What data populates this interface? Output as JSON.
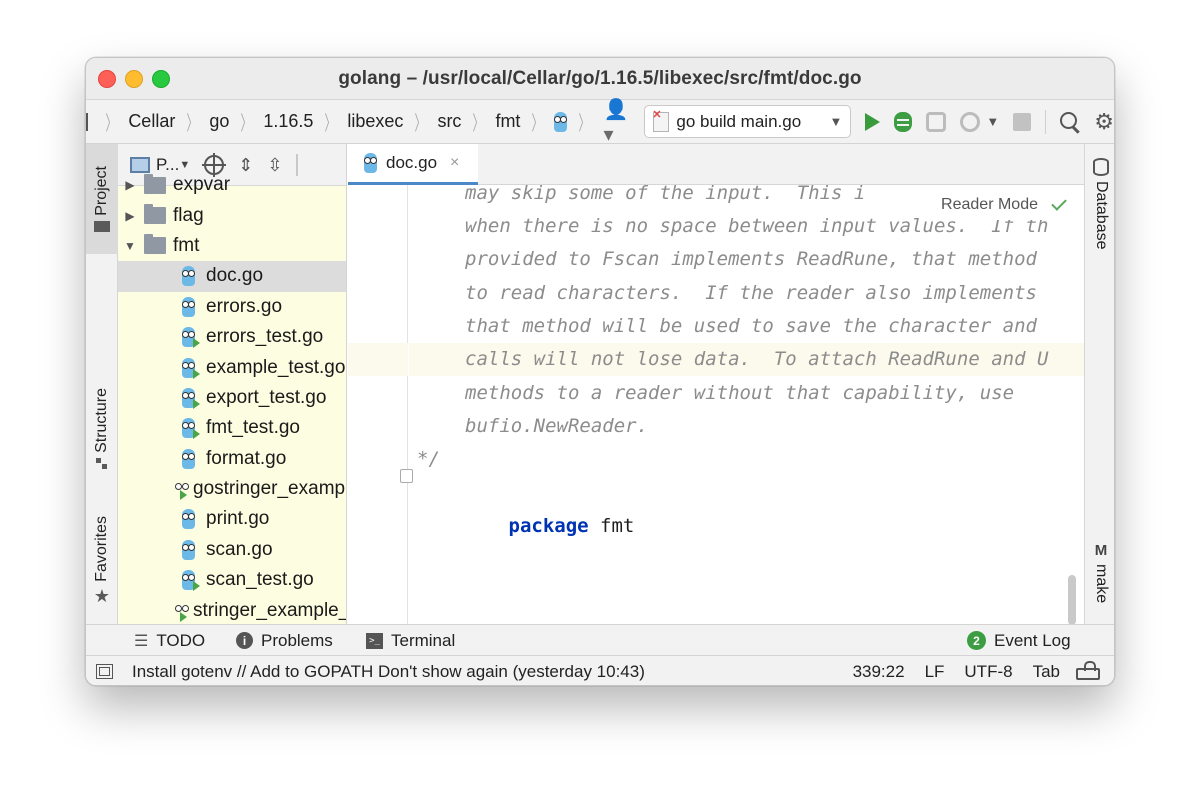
{
  "window": {
    "title": "golang – /usr/local/Cellar/go/1.16.5/libexec/src/fmt/doc.go"
  },
  "breadcrumb": [
    "Cellar",
    "go",
    "1.16.5",
    "libexec",
    "src",
    "fmt"
  ],
  "run_config": {
    "label": "go build main.go"
  },
  "left_tools": {
    "project": "Project",
    "structure": "Structure",
    "favorites": "Favorites"
  },
  "right_tools": {
    "database": "Database",
    "make": "make",
    "make_icon_letter": "M"
  },
  "project_panel": {
    "title": "P...",
    "tree": [
      {
        "name": "expvar",
        "kind": "folder",
        "state": "collapsed"
      },
      {
        "name": "flag",
        "kind": "folder",
        "state": "collapsed"
      },
      {
        "name": "fmt",
        "kind": "folder",
        "state": "expanded"
      },
      {
        "name": "doc.go",
        "kind": "go-file",
        "selected": true
      },
      {
        "name": "errors.go",
        "kind": "go-file"
      },
      {
        "name": "errors_test.go",
        "kind": "go-test-file"
      },
      {
        "name": "example_test.go",
        "kind": "go-test-file"
      },
      {
        "name": "export_test.go",
        "kind": "go-test-file"
      },
      {
        "name": "fmt_test.go",
        "kind": "go-test-file"
      },
      {
        "name": "format.go",
        "kind": "go-file"
      },
      {
        "name": "gostringer_example_test.go",
        "kind": "go-test-file"
      },
      {
        "name": "print.go",
        "kind": "go-file"
      },
      {
        "name": "scan.go",
        "kind": "go-file"
      },
      {
        "name": "scan_test.go",
        "kind": "go-test-file"
      },
      {
        "name": "stringer_example_test.go",
        "kind": "go-test-file"
      }
    ]
  },
  "editor": {
    "tab": {
      "label": "doc.go",
      "close": "×"
    },
    "reader_mode": "Reader Mode",
    "lines": [
      "may skip some of the input.  This i",
      "when there is no space between input values.  If th",
      "provided to Fscan implements ReadRune, that method",
      "to read characters.  If the reader also implements",
      "that method will be used to save the character and",
      "calls will not lose data.  To attach ReadRune and U",
      "methods to a reader without that capability, use",
      "bufio.NewReader.",
      "*/"
    ],
    "package_keyword": "package",
    "package_name": "fmt"
  },
  "tool_windows": {
    "todo": "TODO",
    "problems": "Problems",
    "terminal": "Terminal",
    "event_log": "Event Log",
    "event_log_count": "2"
  },
  "status_bar": {
    "message": "Install gotenv // Add to GOPATH  Don't show again (yesterday 10:43)",
    "position": "339:22",
    "line_separator": "LF",
    "encoding": "UTF-8",
    "indent": "Tab"
  }
}
